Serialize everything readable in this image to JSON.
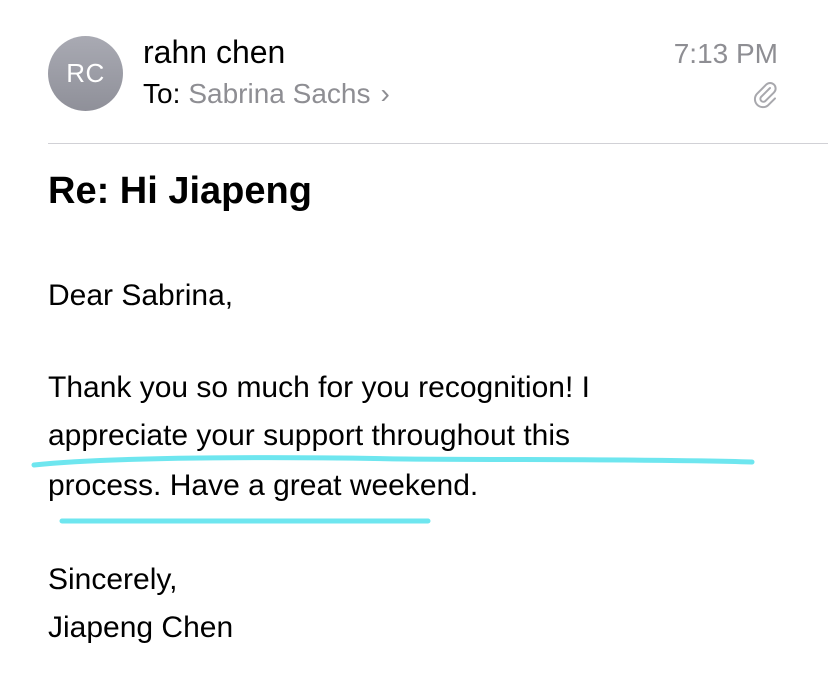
{
  "header": {
    "avatar_initials": "RC",
    "sender_name": "rahn chen",
    "to_label": "To:",
    "recipient": "Sabrina Sachs",
    "chevron": "›",
    "time": "7:13 PM",
    "attachment_icon": "paperclip-icon"
  },
  "message": {
    "subject": "Re: Hi Jiapeng",
    "greeting": "Dear Sabrina,",
    "lines": [
      "Thank you so much for you recognition! I",
      "appreciate your support throughout this",
      "process. Have a great weekend."
    ],
    "closing": "Sincerely,",
    "signature": "Jiapeng Chen"
  },
  "colors": {
    "highlight": "#6ee6ef",
    "secondary_text": "#8e8e93",
    "avatar": "#9b9ca5"
  }
}
